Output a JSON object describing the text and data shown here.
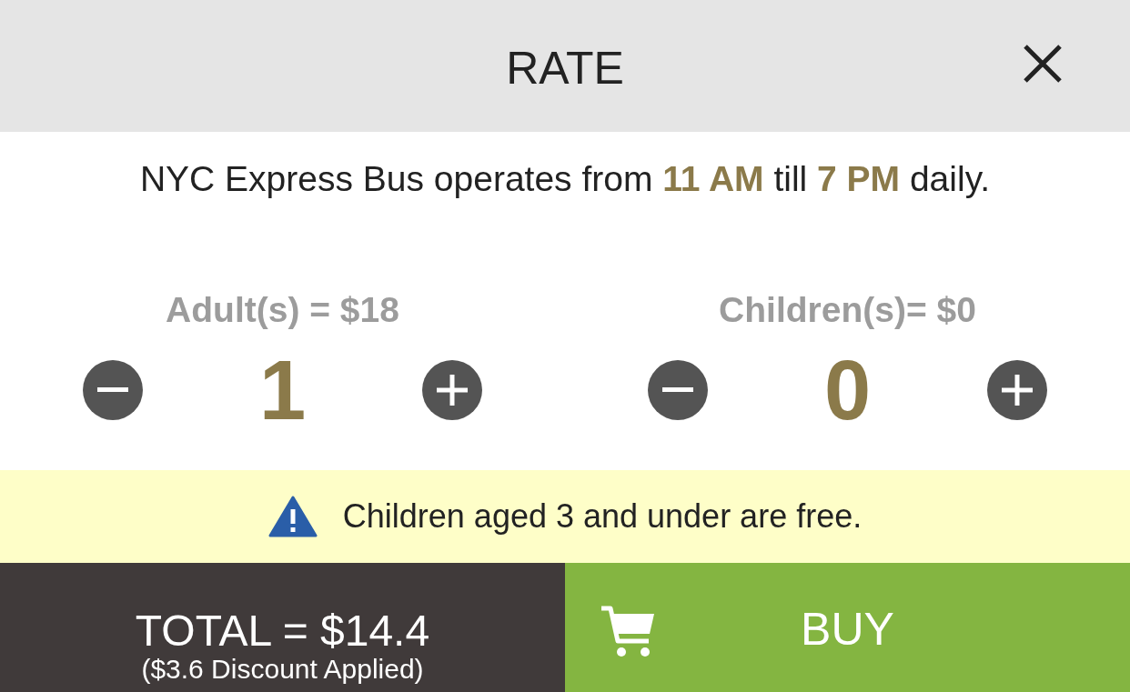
{
  "header": {
    "title": "RATE"
  },
  "notice": "NYC Express Bus operates from **11 AM** till **7 PM** daily.",
  "counters": [
    {
      "label": "Adult(s) = $18",
      "value": "1"
    },
    {
      "label": "Children(s)= $0",
      "value": "0"
    }
  ],
  "banner": {
    "text": "Children aged 3 and under are free."
  },
  "footer": {
    "total": "TOTAL = $14.4",
    "discount": "($3.6 Discount Applied)",
    "buy": "BUY"
  }
}
